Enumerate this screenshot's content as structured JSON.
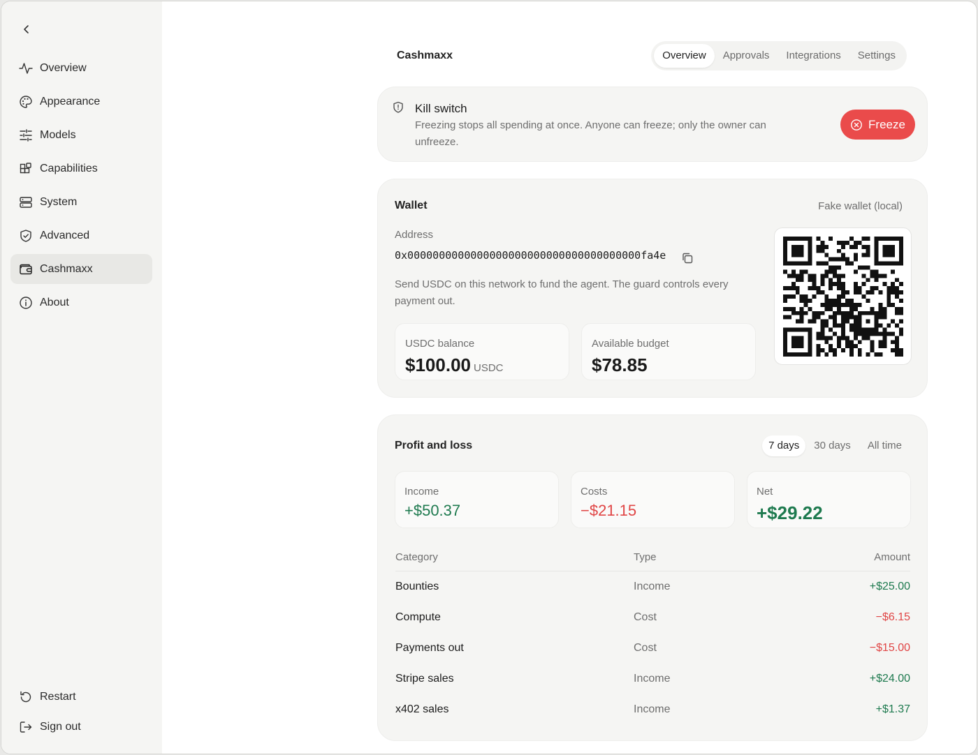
{
  "sidebar": {
    "items": [
      {
        "label": "Overview"
      },
      {
        "label": "Appearance"
      },
      {
        "label": "Models"
      },
      {
        "label": "Capabilities"
      },
      {
        "label": "System"
      },
      {
        "label": "Advanced"
      },
      {
        "label": "Cashmaxx"
      },
      {
        "label": "About"
      }
    ],
    "bottom": [
      {
        "label": "Restart"
      },
      {
        "label": "Sign out"
      }
    ],
    "active": "Cashmaxx"
  },
  "header": {
    "title": "Cashmaxx",
    "tabs": [
      "Overview",
      "Approvals",
      "Integrations",
      "Settings"
    ],
    "active_tab": "Overview"
  },
  "kill_switch": {
    "title": "Kill switch",
    "description": "Freezing stops all spending at once. Anyone can freeze; only the owner can unfreeze.",
    "button": "Freeze"
  },
  "wallet": {
    "title": "Wallet",
    "tag": "Fake wallet (local)",
    "address_label": "Address",
    "address": "0x0000000000000000000000000000000000000fa4e",
    "hint": "Send USDC on this network to fund the agent. The guard controls every payment out.",
    "balance_label": "USDC balance",
    "balance_value": "$100.00",
    "balance_unit": "USDC",
    "budget_label": "Available budget",
    "budget_value": "$78.85"
  },
  "pnl": {
    "title": "Profit and loss",
    "ranges": [
      "7 days",
      "30 days",
      "All time"
    ],
    "active_range": "7 days",
    "income_label": "Income",
    "income_value": "+$50.37",
    "costs_label": "Costs",
    "costs_value": "−$21.15",
    "net_label": "Net",
    "net_value": "+$29.22",
    "columns": [
      "Category",
      "Type",
      "Amount"
    ],
    "rows": [
      {
        "category": "Bounties",
        "type": "Income",
        "amount": "+$25.00"
      },
      {
        "category": "Compute",
        "type": "Cost",
        "amount": "−$6.15"
      },
      {
        "category": "Payments out",
        "type": "Cost",
        "amount": "−$15.00"
      },
      {
        "category": "Stripe sales",
        "type": "Income",
        "amount": "+$24.00"
      },
      {
        "category": "x402 sales",
        "type": "Income",
        "amount": "+$1.37"
      }
    ]
  },
  "colors": {
    "positive": "#1e7a4f",
    "negative": "#e04545",
    "freeze": "#ea4b4b"
  }
}
